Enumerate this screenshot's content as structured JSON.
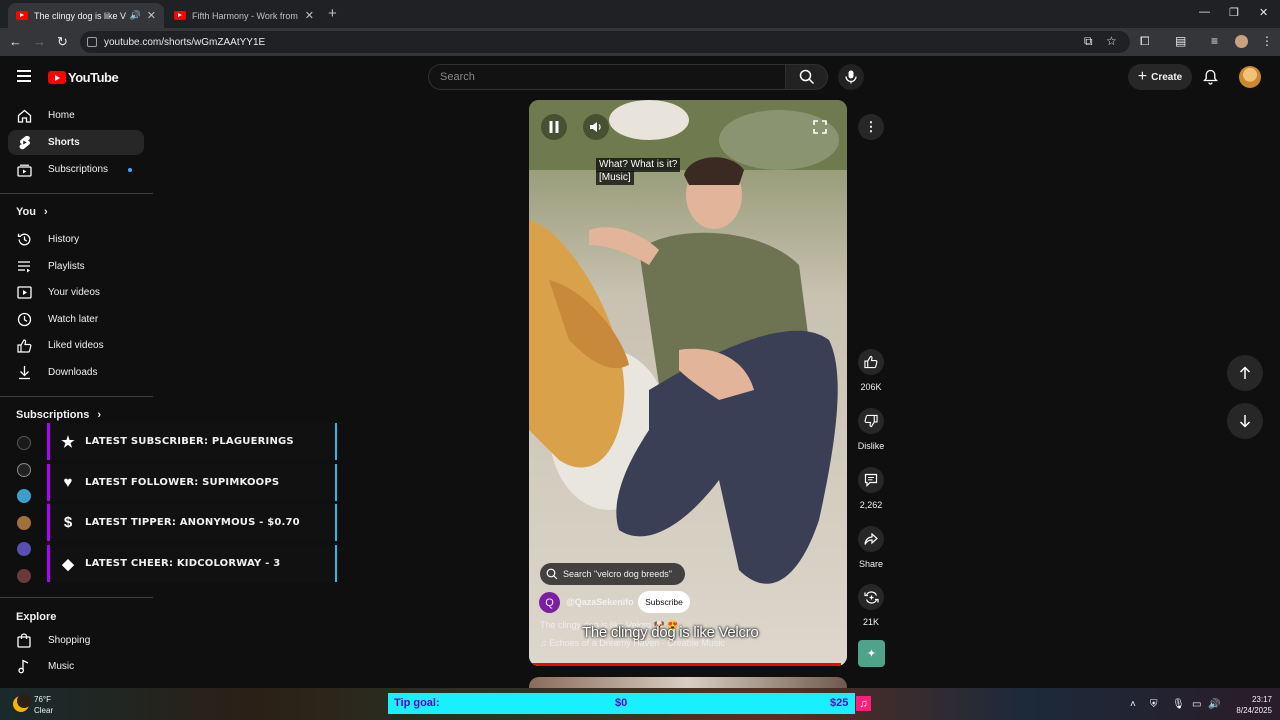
{
  "browser": {
    "tabs": [
      {
        "title": "The clingy dog is like Velcro",
        "active": true
      },
      {
        "title": "Fifth Harmony - Work from Home",
        "active": false
      }
    ],
    "url": "youtube.com/shorts/wGmZAAtYY1E"
  },
  "header": {
    "logo_text": "YouTube",
    "search_placeholder": "Search",
    "create_label": "Create"
  },
  "sidebar": {
    "main": [
      {
        "label": "Home",
        "icon": "home-icon"
      },
      {
        "label": "Shorts",
        "icon": "shorts-icon",
        "selected": true
      },
      {
        "label": "Subscriptions",
        "icon": "subscriptions-icon"
      }
    ],
    "you_heading": "You",
    "you_items": [
      {
        "label": "History",
        "icon": "history-icon"
      },
      {
        "label": "Playlists",
        "icon": "playlists-icon"
      },
      {
        "label": "Your videos",
        "icon": "your-videos-icon"
      },
      {
        "label": "Watch later",
        "icon": "watch-later-icon"
      },
      {
        "label": "Liked videos",
        "icon": "liked-videos-icon"
      },
      {
        "label": "Downloads",
        "icon": "downloads-icon"
      }
    ],
    "subscriptions_heading": "Subscriptions",
    "explore_heading": "Explore",
    "explore_items": [
      {
        "label": "Shopping",
        "icon": "shopping-icon"
      },
      {
        "label": "Music",
        "icon": "music-icon"
      }
    ]
  },
  "stream_alerts": [
    {
      "text": "Latest Subscriber: Plaguerings",
      "icon": "star-icon"
    },
    {
      "text": "Latest Follower: supimkoops",
      "icon": "heart-icon"
    },
    {
      "text": "Latest Tipper: Anonymous - $0.70",
      "icon": "dollar-icon"
    },
    {
      "text": "Latest Cheer: kidcolorway - 3",
      "icon": "diamond-icon"
    }
  ],
  "short": {
    "captions": [
      "What? What is it?",
      "[Music]"
    ],
    "search_suggestion": "Search \"velcro dog breeds\"",
    "channel_initial": "Q",
    "channel": "@QazaSekenifo",
    "subscribe_label": "Subscribe",
    "title": "The clingy dog is like Velcro 🐶 😍",
    "burned_subtitle": "The clingy dog is like Velcro",
    "music": "♫ Echoes of a Dreamy Haven · Creable Music",
    "progress": 0.98
  },
  "actions": {
    "likes": "206K",
    "dislike_label": "Dislike",
    "comments": "2,262",
    "share_label": "Share",
    "remix": "21K"
  },
  "taskbar": {
    "temp": "76°F",
    "condition": "Clear",
    "tip_goal_label": "Tip goal:",
    "tip_current": "$0",
    "tip_target": "$25",
    "time": "23:17",
    "date": "8/24/2025"
  },
  "colors": {
    "accent_red": "#ff0000",
    "tip_bar": "#19f0ff",
    "alert_border": "#b200ff"
  }
}
